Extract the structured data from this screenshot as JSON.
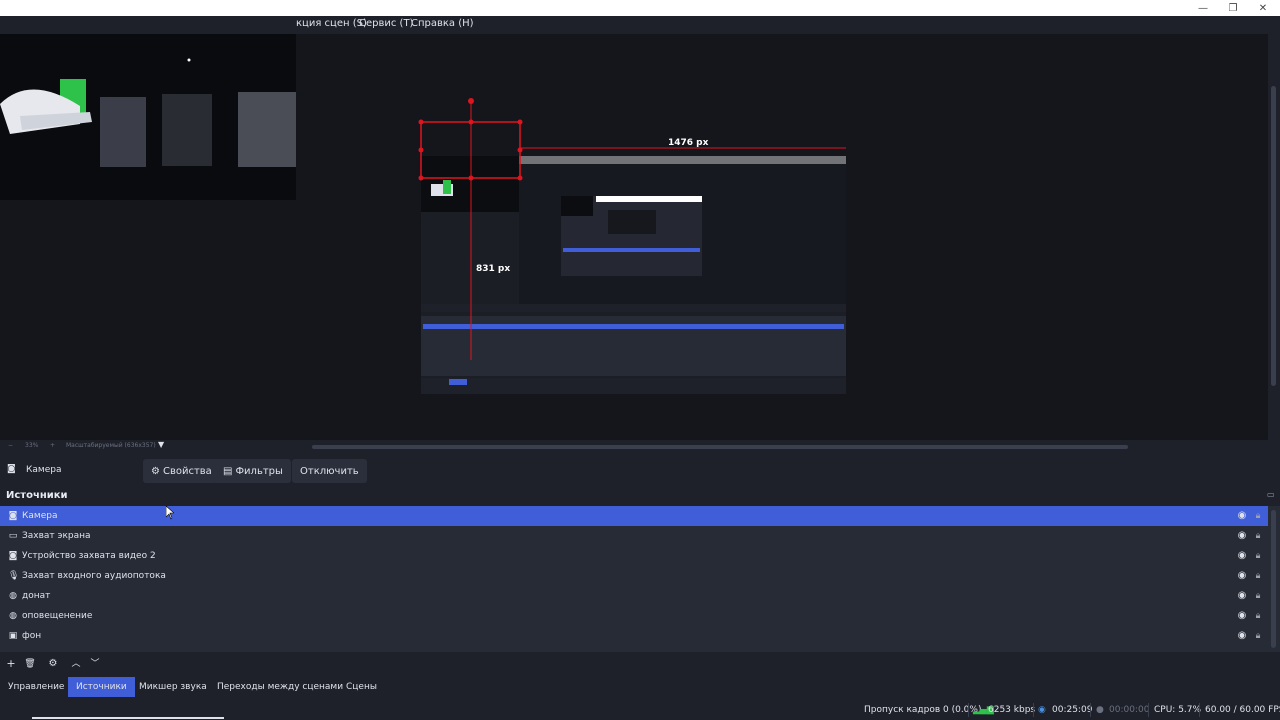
{
  "window": {
    "minimize": "—",
    "restore": "❐",
    "close": "✕"
  },
  "menu": {
    "items": [
      "кция сцен (S)",
      "Сервис (T)",
      "Справка (H)"
    ]
  },
  "preview": {
    "width_label": "1476 px",
    "height_label": "831 px"
  },
  "zoom": {
    "minus": "−",
    "level": "33%",
    "plus": "+",
    "mode": "Масштабируемый (636x357)"
  },
  "source_toolbar": {
    "source_name": "Камера",
    "properties_label": "Свойства",
    "filters_label": "Фильтры",
    "disable_label": "Отключить"
  },
  "sources_panel": {
    "title": "Источники",
    "items": [
      {
        "label": "Камера",
        "icon": "camera-icon",
        "selected": true
      },
      {
        "label": "Захват экрана",
        "icon": "monitor-icon",
        "selected": false
      },
      {
        "label": "Устройство захвата видео 2",
        "icon": "camera-icon",
        "selected": false
      },
      {
        "label": "Захват входного аудиопотока",
        "icon": "microphone-icon",
        "selected": false
      },
      {
        "label": "донат",
        "icon": "globe-icon",
        "selected": false
      },
      {
        "label": "оповещенение",
        "icon": "globe-icon",
        "selected": false
      },
      {
        "label": "фон",
        "icon": "image-icon",
        "selected": false
      }
    ]
  },
  "dock_tabs": [
    "Управление",
    "Источники",
    "Микшер звука",
    "Переходы между сценами",
    "Сцены"
  ],
  "active_tab": "Источники",
  "status": {
    "dropped_frames": "Пропуск кадров 0 (0.0%)",
    "bitrate": "6253 kbps",
    "stream_time": "00:25:09",
    "record_time": "00:00:00",
    "cpu": "CPU: 5.7%",
    "fps": "60.00 / 60.00 FPS"
  },
  "colors": {
    "accent": "#3f5ed8",
    "background": "#1e2129",
    "panel": "#272b35",
    "guide": "#e0141e"
  }
}
